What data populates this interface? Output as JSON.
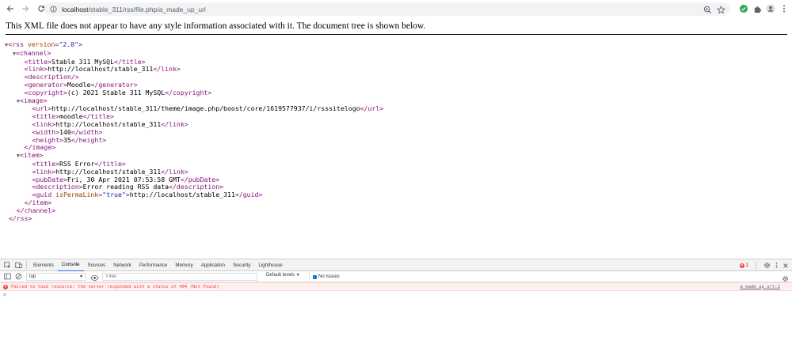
{
  "browser": {
    "url_host": "localhost",
    "url_path": "/stable_311/rss/file.php/a_made_up_url"
  },
  "xml_viewer": {
    "header": "This XML file does not appear to have any style information associated with it. The document tree is shown below."
  },
  "xml": {
    "rss_version": "2.0",
    "channel": {
      "title": "Stable 311 MySQL",
      "link": "http://localhost/stable_311",
      "generator": "Moodle",
      "copyright": "(c) 2021 Stable 311 MySQL",
      "image": {
        "url": "http://localhost/stable_311/theme/image.php/boost/core/1619577937/i/rsssitelogo",
        "title": "moodle",
        "link": "http://localhost/stable_311",
        "width": "140",
        "height": "35"
      },
      "item": {
        "title": "RSS Error",
        "link": "http://localhost/stable_311",
        "pubDate": "Fri, 30 Apr 2021 07:53:58 GMT",
        "description": "Error reading RSS data",
        "guid_isPermaLink": "true",
        "guid": "http://localhost/stable_311"
      }
    }
  },
  "devtools": {
    "tabs": [
      "Elements",
      "Console",
      "Sources",
      "Network",
      "Performance",
      "Memory",
      "Application",
      "Security",
      "Lighthouse"
    ],
    "active_tab": "Console",
    "error_count": "1",
    "context": "top",
    "filter_placeholder": "Filter",
    "levels_label": "Default levels",
    "issues_label": "No Issues",
    "error_message": "Failed to load resource: the server responded with a status of 404 (Not Found)",
    "error_source": "a_made_up_url:1",
    "prompt": ">"
  },
  "colors": {
    "tag": "#881280",
    "attr": "#994500",
    "attr_value": "#1a1aa6",
    "accent": "#1a73e8",
    "error": "#e8453c"
  }
}
